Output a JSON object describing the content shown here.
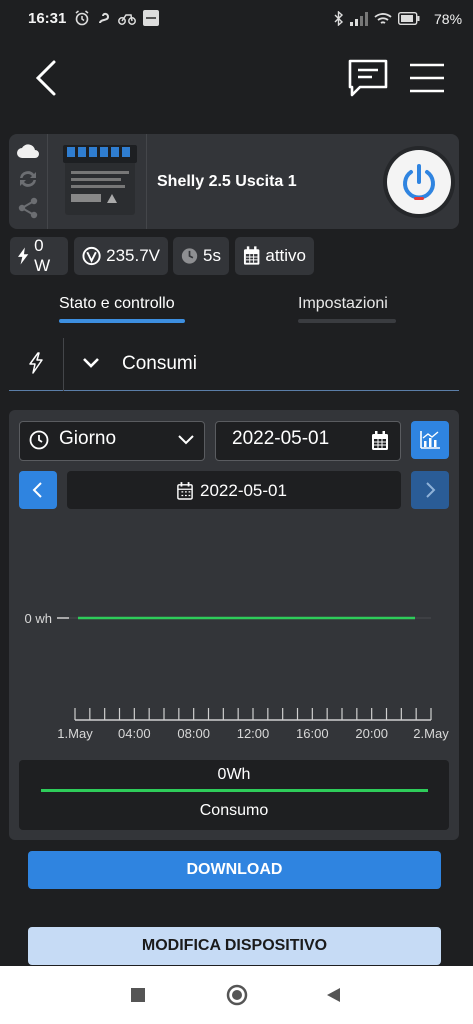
{
  "status_bar": {
    "time": "16:31",
    "battery": "78%"
  },
  "app_bar": {
    "back_icon": "arrow-left-icon",
    "chat_icon": "chat-icon",
    "menu_icon": "hamburger-menu-icon"
  },
  "device": {
    "name": "Shelly 2.5 Uscita 1",
    "power_button_color": "#e53935"
  },
  "chips": {
    "power": "0 W",
    "voltage": "235.7V",
    "interval": "5s",
    "schedule": "attivo"
  },
  "tabs": [
    {
      "label": "Stato e controllo",
      "active": true
    },
    {
      "label": "Impostazioni",
      "active": false
    }
  ],
  "section": {
    "label": "Consumi"
  },
  "chart_controls": {
    "period": "Giorno",
    "date": "2022-05-01",
    "nav_date": "2022-05-01"
  },
  "chart_data": {
    "type": "line",
    "x": [
      "1.May",
      "04:00",
      "08:00",
      "12:00",
      "16:00",
      "20:00",
      "2.May"
    ],
    "series": [
      {
        "name": "Consumo",
        "values": [
          0,
          0,
          0,
          0,
          0,
          0,
          0
        ],
        "color": "#2ecc5a"
      }
    ],
    "y_tick_label": "0 wh",
    "total_label": "0Wh"
  },
  "buttons": {
    "download": "DOWNLOAD",
    "edit": "MODIFICA DISPOSITIVO"
  },
  "colors": {
    "accent": "#2f84e0",
    "tab_active": "#3d8fe0",
    "background": "#1e1f21",
    "card": "#333539"
  }
}
